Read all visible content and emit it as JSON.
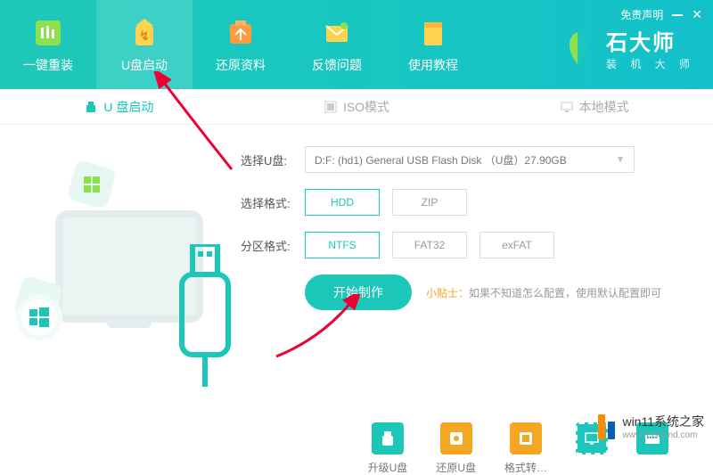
{
  "header": {
    "disclaimer": "免责声明",
    "brand": {
      "name": "石大师",
      "sub": "装 机 大 师"
    },
    "nav": [
      {
        "label": "一键重装",
        "icon": "bars-icon"
      },
      {
        "label": "U盘启动",
        "icon": "usb-boot-icon",
        "active": true
      },
      {
        "label": "还原资料",
        "icon": "restore-icon"
      },
      {
        "label": "反馈问题",
        "icon": "feedback-icon"
      },
      {
        "label": "使用教程",
        "icon": "tutorial-icon"
      }
    ]
  },
  "tabs": [
    {
      "label": "U 盘启动",
      "icon": "usb-icon",
      "active": true
    },
    {
      "label": "ISO模式",
      "icon": "iso-icon"
    },
    {
      "label": "本地模式",
      "icon": "local-icon"
    }
  ],
  "form": {
    "select_usb_label": "选择U盘:",
    "select_usb_value": "D:F: (hd1) General USB Flash Disk （U盘）27.90GB",
    "format_label": "选择格式:",
    "format_options": [
      "HDD",
      "ZIP"
    ],
    "format_selected": "HDD",
    "partition_label": "分区格式:",
    "partition_options": [
      "NTFS",
      "FAT32",
      "exFAT"
    ],
    "partition_selected": "NTFS",
    "start_button": "开始制作",
    "tip_prefix": "小贴士：",
    "tip_text": "如果不知道怎么配置，使用默认配置即可"
  },
  "bottom": [
    {
      "label": "升级U盘",
      "icon": "upgrade-icon",
      "color": "b-teal"
    },
    {
      "label": "还原U盘",
      "icon": "restore-usb-icon",
      "color": "b-orange"
    },
    {
      "label": "格式转…",
      "icon": "format-convert-icon",
      "color": "b-orange"
    },
    {
      "label": "",
      "icon": "screen-icon",
      "color": "b-teal2"
    },
    {
      "label": "",
      "icon": "keyboard-icon",
      "color": "b-teal"
    }
  ],
  "overlay": {
    "title": "win11系统之家",
    "url": "www.relsound.com"
  }
}
